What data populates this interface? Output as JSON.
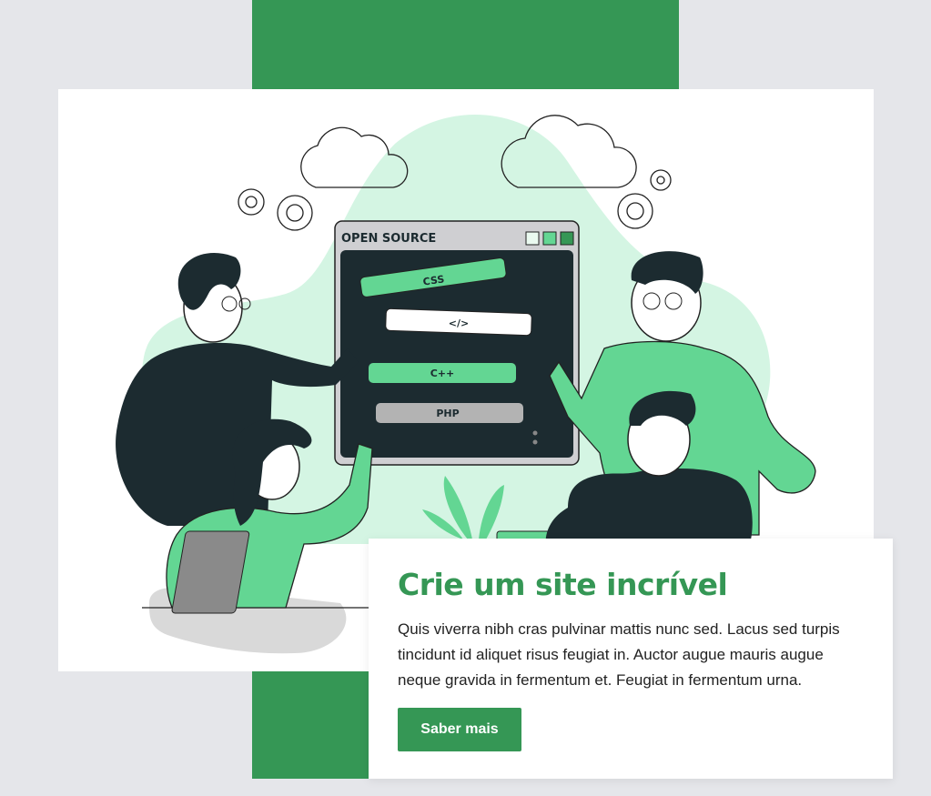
{
  "illustration": {
    "window_title": "OPEN SOURCE",
    "tags": [
      "CSS",
      "</>",
      "C++",
      "PHP"
    ]
  },
  "hero": {
    "headline": "Crie um site incrível",
    "body": "Quis viverra nibh cras pulvinar mattis nunc sed. Lacus sed turpis tincidunt id aliquet risus feugiat in. Auctor augue mauris augue neque gravida in fermentum et. Feugiat in fermentum urna.",
    "cta_label": "Saber mais"
  },
  "colors": {
    "brand_green": "#359755",
    "accent_green": "#63d693",
    "light_green": "#d4f5e3",
    "dark": "#1c2b30",
    "background": "#e5e6ea"
  }
}
